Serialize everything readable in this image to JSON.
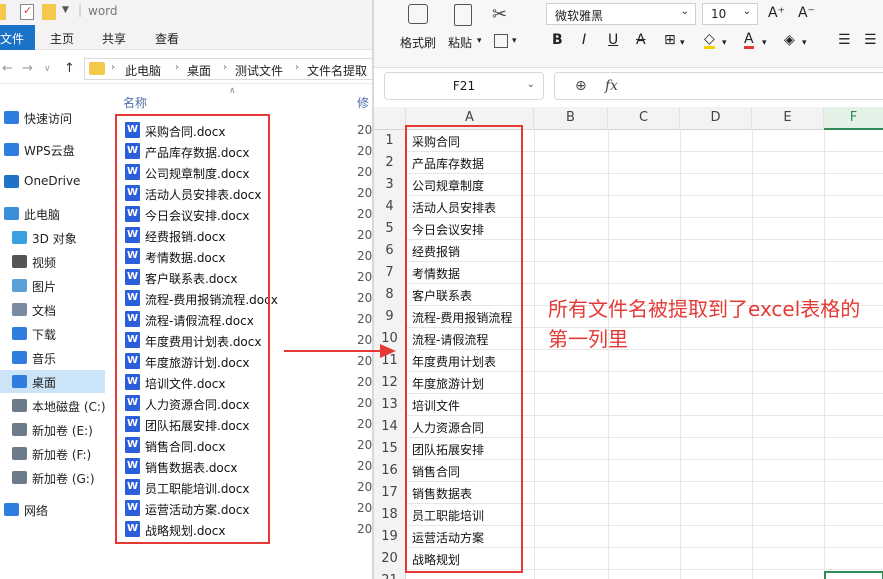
{
  "explorer": {
    "window_title": "word",
    "ribbon_tabs": [
      "文件",
      "主页",
      "共享",
      "查看"
    ],
    "breadcrumb": [
      "此电脑",
      "桌面",
      "测试文件",
      "文件名提取"
    ],
    "nav_items": [
      {
        "label": "快速访问",
        "icon": "star-icon",
        "color": "#2f7de1"
      },
      {
        "label": "WPS云盘",
        "icon": "cloud-icon",
        "color": "#2f7de1"
      },
      {
        "label": "OneDrive",
        "icon": "cloud-icon",
        "color": "#1e73c8"
      },
      {
        "label": "此电脑",
        "icon": "computer-icon",
        "color": "#3b8ed8"
      },
      {
        "label": "3D 对象",
        "icon": "cube-icon",
        "color": "#3aa0e0"
      },
      {
        "label": "视频",
        "icon": "video-icon",
        "color": "#555555"
      },
      {
        "label": "图片",
        "icon": "picture-icon",
        "color": "#5a9fd6"
      },
      {
        "label": "文档",
        "icon": "document-icon",
        "color": "#7a8aa0"
      },
      {
        "label": "下载",
        "icon": "download-icon",
        "color": "#2f7de1"
      },
      {
        "label": "音乐",
        "icon": "music-icon",
        "color": "#2f7de1"
      },
      {
        "label": "桌面",
        "icon": "desktop-icon",
        "color": "#2f7de1"
      },
      {
        "label": "本地磁盘 (C:)",
        "icon": "drive-icon",
        "color": "#6c7a89"
      },
      {
        "label": "新加卷 (E:)",
        "icon": "drive-icon",
        "color": "#6c7a89"
      },
      {
        "label": "新加卷 (F:)",
        "icon": "drive-icon",
        "color": "#6c7a89"
      },
      {
        "label": "新加卷 (G:)",
        "icon": "drive-icon",
        "color": "#6c7a89"
      },
      {
        "label": "网络",
        "icon": "network-icon",
        "color": "#2f7de1"
      }
    ],
    "columns": {
      "name": "名称",
      "modified": "修"
    },
    "date_prefix": "20",
    "files": [
      "采购合同.docx",
      "产品库存数据.docx",
      "公司规章制度.docx",
      "活动人员安排表.docx",
      "今日会议安排.docx",
      "经费报销.docx",
      "考情数据.docx",
      "客户联系表.docx",
      "流程-费用报销流程.docx",
      "流程-请假流程.docx",
      "年度费用计划表.docx",
      "年度旅游计划.docx",
      "培训文件.docx",
      "人力资源合同.docx",
      "团队拓展安排.docx",
      "销售合同.docx",
      "销售数据表.docx",
      "员工职能培训.docx",
      "运营活动方案.docx",
      "战略规划.docx"
    ],
    "word_icon_letter": "W"
  },
  "sheet": {
    "ribbon": {
      "format_painter": "格式刷",
      "paste": "粘贴",
      "font_name": "微软雅黑",
      "font_size": "10",
      "bold": "B",
      "italic": "I",
      "underline": "U",
      "strike": "A"
    },
    "name_box": "F21",
    "fx_label": "fx",
    "column_headers": [
      "A",
      "B",
      "C",
      "D",
      "E",
      "F"
    ],
    "selected_column": "F",
    "rows": [
      {
        "n": "1",
        "a": "采购合同"
      },
      {
        "n": "2",
        "a": "产品库存数据"
      },
      {
        "n": "3",
        "a": "公司规章制度"
      },
      {
        "n": "4",
        "a": "活动人员安排表"
      },
      {
        "n": "5",
        "a": "今日会议安排"
      },
      {
        "n": "6",
        "a": "经费报销"
      },
      {
        "n": "7",
        "a": "考情数据"
      },
      {
        "n": "8",
        "a": "客户联系表"
      },
      {
        "n": "9",
        "a": "流程-费用报销流程"
      },
      {
        "n": "10",
        "a": "流程-请假流程"
      },
      {
        "n": "11",
        "a": "年度费用计划表"
      },
      {
        "n": "12",
        "a": "年度旅游计划"
      },
      {
        "n": "13",
        "a": "培训文件"
      },
      {
        "n": "14",
        "a": "人力资源合同"
      },
      {
        "n": "15",
        "a": "团队拓展安排"
      },
      {
        "n": "16",
        "a": "销售合同"
      },
      {
        "n": "17",
        "a": "销售数据表"
      },
      {
        "n": "18",
        "a": "员工职能培训"
      },
      {
        "n": "19",
        "a": "运营活动方案"
      },
      {
        "n": "20",
        "a": "战略规划"
      },
      {
        "n": "21",
        "a": ""
      }
    ]
  },
  "annotation": {
    "text": "所有文件名被提取到了excel表格的第一列里",
    "color": "#e53935"
  }
}
